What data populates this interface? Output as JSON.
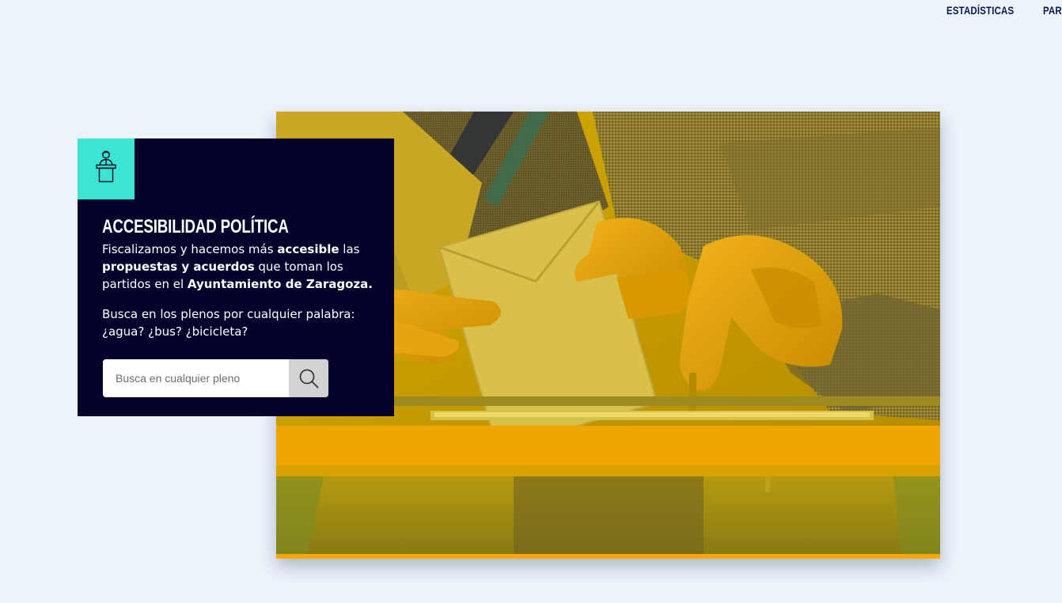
{
  "nav": {
    "items": [
      {
        "label": "ESTADÍSTICAS"
      },
      {
        "label": "PAR"
      }
    ]
  },
  "hero": {
    "title": "ACCESIBILIDAD POLÍTICA",
    "description": {
      "p1": "Fiscalizamos y hacemos más ",
      "b1": "accesible",
      "p2": " las ",
      "b2": "propuestas y acuerdos",
      "p3": " que toman los partidos en el ",
      "b3": "Ayuntamiento de Zaragoza."
    },
    "prompt": "Busca en los plenos por cualquier palabra: ¿agua? ¿bus? ¿bicicleta?",
    "icon": "speaker-podium-icon"
  },
  "search": {
    "placeholder": "Busca en cualquier pleno",
    "value": "",
    "icon": "search-icon"
  },
  "colors": {
    "background": "#eef4fc",
    "card": "#03022a",
    "accent": "#3de3d3",
    "photo_tint": "#e0a800",
    "nav_text": "#0a1a4c"
  }
}
